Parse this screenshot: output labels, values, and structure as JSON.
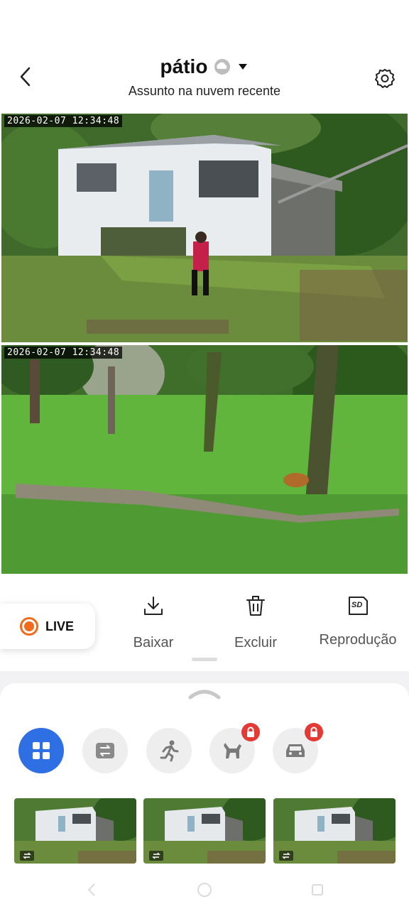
{
  "header": {
    "title": "pátio",
    "subtitle": "Assunto na nuvem recente"
  },
  "videos": [
    {
      "timestamp": "2026-02-07 12:34:48"
    },
    {
      "timestamp": "2026-02-07 12:34:48"
    }
  ],
  "actions": {
    "live_label": "LIVE",
    "download_label": "Baixar",
    "delete_label": "Excluir",
    "playback_label": "Reprodução",
    "sd_text": "SD"
  },
  "filters": [
    {
      "icon": "grid-icon",
      "active": true,
      "locked": false
    },
    {
      "icon": "swap-icon",
      "active": false,
      "locked": false
    },
    {
      "icon": "person-running-icon",
      "active": false,
      "locked": true
    },
    {
      "icon": "pet-icon",
      "active": false,
      "locked": true
    },
    {
      "icon": "car-icon",
      "active": false,
      "locked": true
    }
  ],
  "colors": {
    "accent": "#2f6fe4",
    "live": "#f26a1b",
    "lock": "#e53935"
  }
}
